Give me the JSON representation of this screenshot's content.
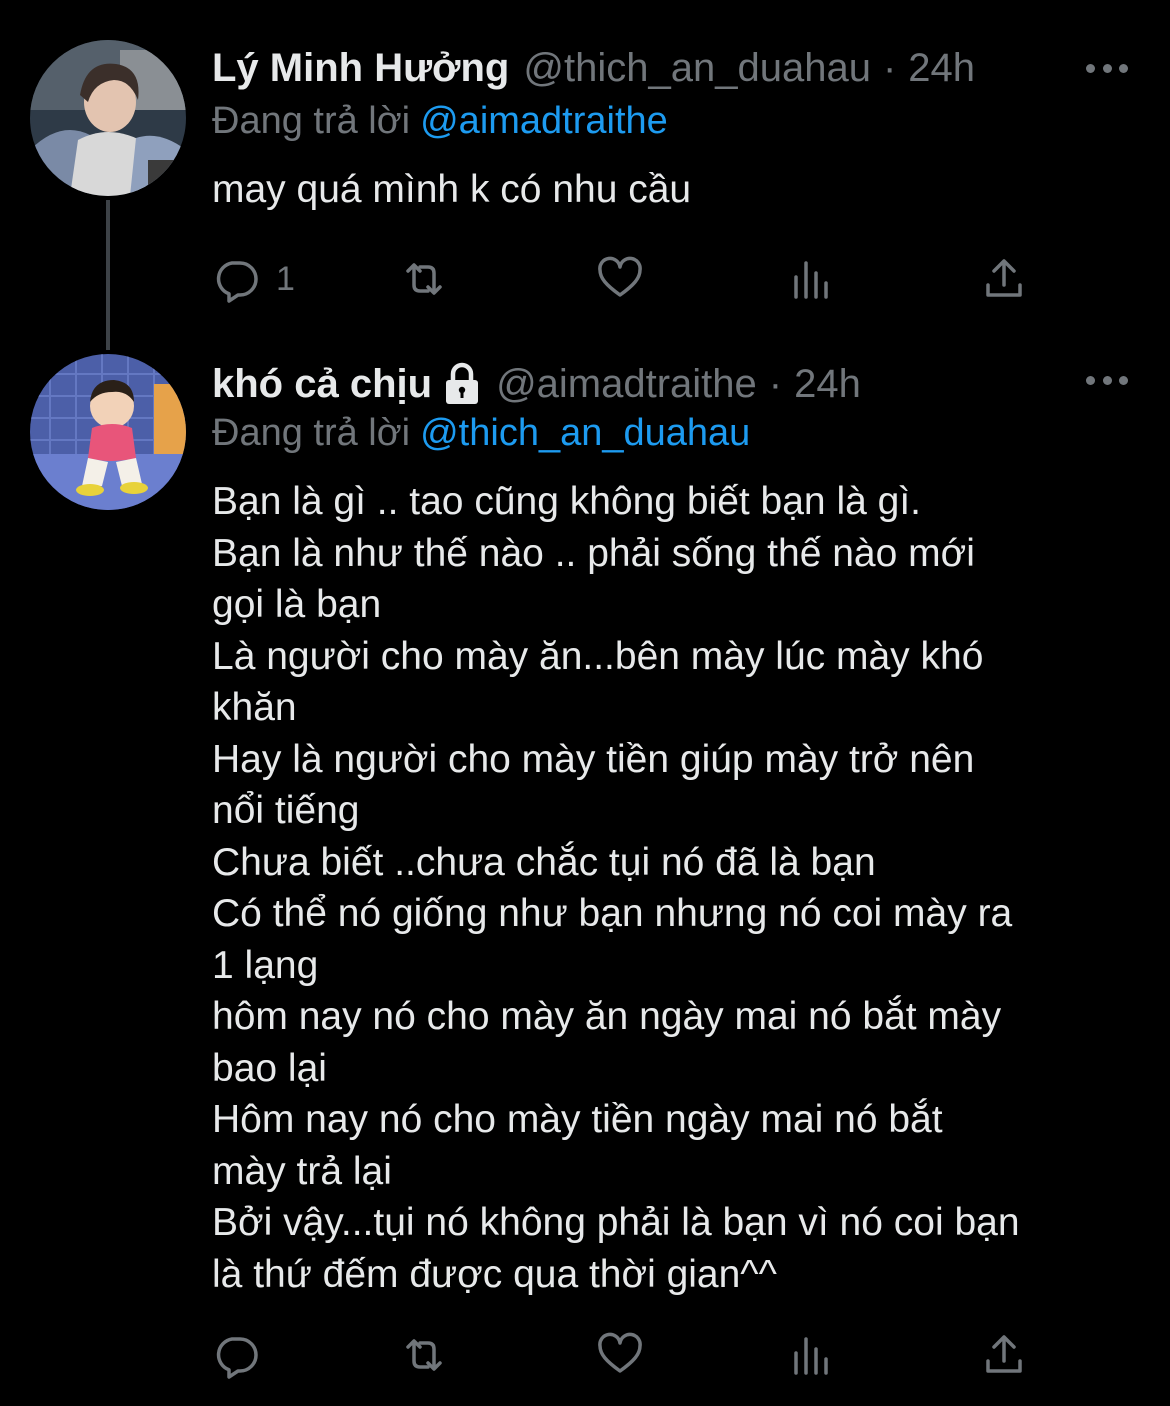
{
  "tweets": [
    {
      "display_name": "Lý Minh Hưởng",
      "handle": "@thich_an_duahau",
      "separator": "·",
      "time": "24h",
      "reply_prefix": "Đang trả lời",
      "reply_to": "@aimadtraithe",
      "lines": [
        "may quá mình k có nhu cầu"
      ],
      "reply_count": "1",
      "protected": false
    },
    {
      "display_name": "khó cả chịu",
      "handle": "@aimadtraithe",
      "separator": "·",
      "time": "24h",
      "reply_prefix": "Đang trả lời",
      "reply_to": "@thich_an_duahau",
      "lines": [
        "Bạn là gì .. tao cũng không biết bạn là gì.",
        "Bạn là như thế nào .. phải sống thế nào mới",
        "gọi là bạn",
        "Là người cho mày ăn...bên mày lúc mày khó",
        "khăn",
        "Hay là người cho mày tiền giúp mày trở nên",
        "nổi tiếng",
        "Chưa biết ..chưa chắc tụi nó đã là bạn",
        "Có thể nó giống như bạn nhưng nó coi mày ra",
        "1 lạng",
        "hôm nay nó cho mày ăn ngày mai nó bắt mày",
        "bao lại",
        "Hôm nay nó cho mày tiền ngày mai nó bắt",
        "mày trả lại",
        "Bởi vậy...tụi nó không phải là bạn vì nó coi bạn",
        "là thứ đếm được qua thời gian^^"
      ],
      "reply_count": "",
      "protected": true
    }
  ],
  "icons": {
    "reply": "reply-icon",
    "retweet": "retweet-icon",
    "like": "heart-icon",
    "views": "views-icon",
    "share": "share-icon",
    "more": "more-icon",
    "lock": "lock-icon"
  },
  "colors": {
    "background": "#000000",
    "text": "#e7e9ea",
    "secondary": "#71767b",
    "mention": "#1d9bf0",
    "thread_line": "#3d4247"
  }
}
